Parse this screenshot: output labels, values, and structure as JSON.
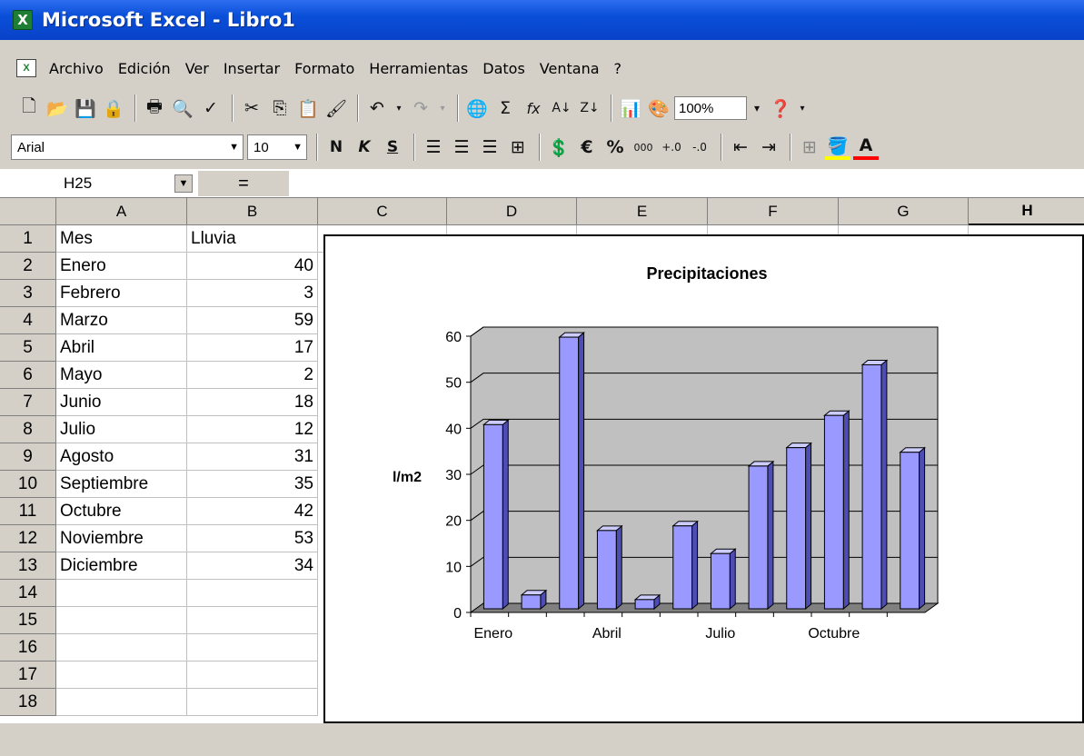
{
  "window": {
    "title": "Microsoft Excel - Libro1",
    "app_icon": "excel-icon"
  },
  "menu": [
    "Archivo",
    "Edición",
    "Ver",
    "Insertar",
    "Formato",
    "Herramientas",
    "Datos",
    "Ventana",
    "?"
  ],
  "toolbar_standard": {
    "zoom": "100%"
  },
  "toolbar_format": {
    "font": "Arial",
    "size": "10",
    "bold": "N",
    "italic": "K",
    "underline": "S",
    "euro": "€",
    "percent": "%",
    "thousands": "000"
  },
  "formula_bar": {
    "cell_ref": "H25",
    "equals": "="
  },
  "columns": [
    "A",
    "B",
    "C",
    "D",
    "E",
    "F",
    "G",
    "H"
  ],
  "rows": [
    "1",
    "2",
    "3",
    "4",
    "5",
    "6",
    "7",
    "8",
    "9",
    "10",
    "11",
    "12",
    "13",
    "14",
    "15",
    "16",
    "17",
    "18"
  ],
  "cells": [
    [
      "Mes",
      "Lluvia"
    ],
    [
      "Enero",
      "40"
    ],
    [
      "Febrero",
      "3"
    ],
    [
      "Marzo",
      "59"
    ],
    [
      "Abril",
      "17"
    ],
    [
      "Mayo",
      "2"
    ],
    [
      "Junio",
      "18"
    ],
    [
      "Julio",
      "12"
    ],
    [
      "Agosto",
      "31"
    ],
    [
      "Septiembre",
      "35"
    ],
    [
      "Octubre",
      "42"
    ],
    [
      "Noviembre",
      "53"
    ],
    [
      "Diciembre",
      "34"
    ]
  ],
  "chart_data": {
    "type": "bar",
    "title": "Precipitaciones",
    "ylabel": "l/m2",
    "xlabel": "",
    "categories": [
      "Enero",
      "Febrero",
      "Marzo",
      "Abril",
      "Mayo",
      "Junio",
      "Julio",
      "Agosto",
      "Septiembre",
      "Octubre",
      "Noviembre",
      "Diciembre"
    ],
    "category_labels_shown": [
      "Enero",
      "",
      "",
      "Abril",
      "",
      "",
      "Julio",
      "",
      "",
      "Octubre",
      "",
      ""
    ],
    "values": [
      40,
      3,
      59,
      17,
      2,
      18,
      12,
      31,
      35,
      42,
      53,
      34
    ],
    "ylim": [
      0,
      60
    ],
    "yticks": [
      "0",
      "10",
      "20",
      "30",
      "40",
      "50",
      "60"
    ],
    "bar_color": "#9999ff",
    "wall_color": "#c0c0c0",
    "floor_color": "#808080",
    "grid": true
  }
}
